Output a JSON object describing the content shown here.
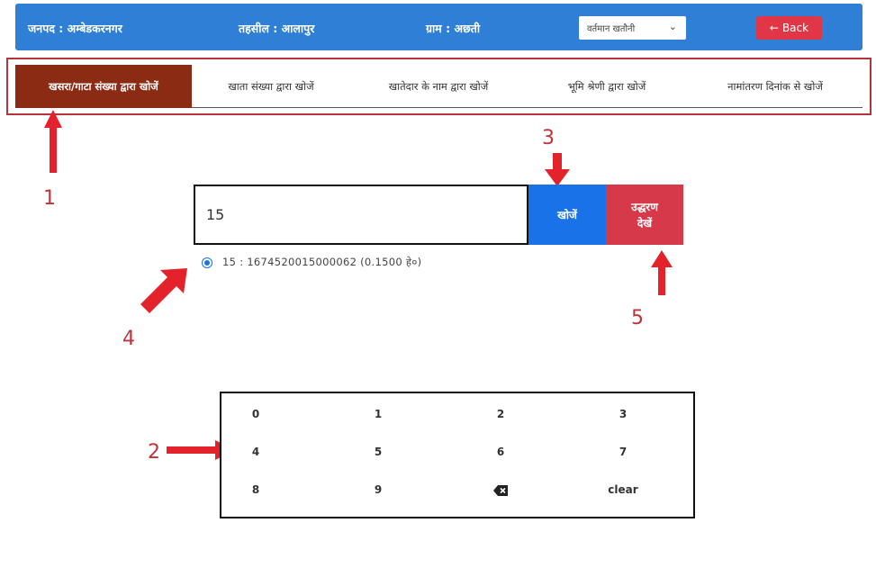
{
  "header": {
    "district": "जनपद : अम्बेडकरनगर",
    "tehsil": "तहसील : आलापुर",
    "village": "ग्राम : अछती",
    "khatauni_select": "वर्तमान खतौनी",
    "back_label": "Back"
  },
  "tabs": [
    {
      "label": "खसरा/गाटा संख्या द्वारा खोजें",
      "active": true
    },
    {
      "label": "खाता संख्या द्वारा खोजें",
      "active": false
    },
    {
      "label": "खातेदार के नाम द्वारा खोजें",
      "active": false
    },
    {
      "label": "भूमि श्रेणी द्वारा खोजें",
      "active": false
    },
    {
      "label": "नामांतरण दिनांक से खोजें",
      "active": false
    }
  ],
  "search": {
    "value": "15",
    "search_label": "खोजें",
    "extract_label_line1": "उद्धरण",
    "extract_label_line2": "देखें"
  },
  "result": {
    "text": "15 : 1674520015000062  (0.1500 हे०)"
  },
  "keypad": {
    "keys": [
      "0",
      "1",
      "2",
      "3",
      "4",
      "5",
      "6",
      "7",
      "8",
      "9",
      "backspace",
      "clear"
    ]
  },
  "annotations": {
    "labels": [
      "1",
      "2",
      "3",
      "4",
      "5"
    ],
    "color": "#e3222c"
  },
  "colors": {
    "header_bg": "#2f7fd6",
    "active_tab": "#8b2b14",
    "search_button": "#1a72e8",
    "extract_button": "#d5394a",
    "back_button": "#e03645"
  }
}
